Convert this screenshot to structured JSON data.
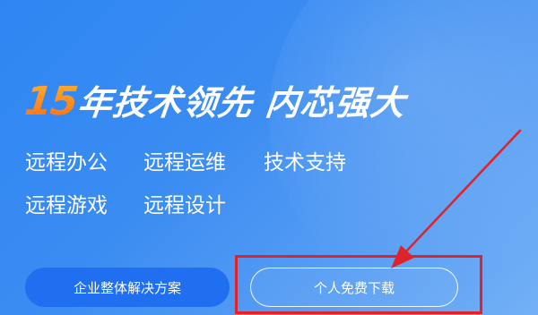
{
  "hero": {
    "title_number": "15",
    "title_text": "年技术领先 内芯强大",
    "features": [
      "远程办公",
      "远程运维",
      "技术支持",
      "远程游戏",
      "远程设计"
    ]
  },
  "buttons": {
    "enterprise_label": "企业整体解决方案",
    "download_label": "个人免费下载"
  },
  "colors": {
    "accent_orange": "#ff8a1e",
    "button_blue": "#1f6ff0",
    "highlight_red": "#e0222a"
  }
}
